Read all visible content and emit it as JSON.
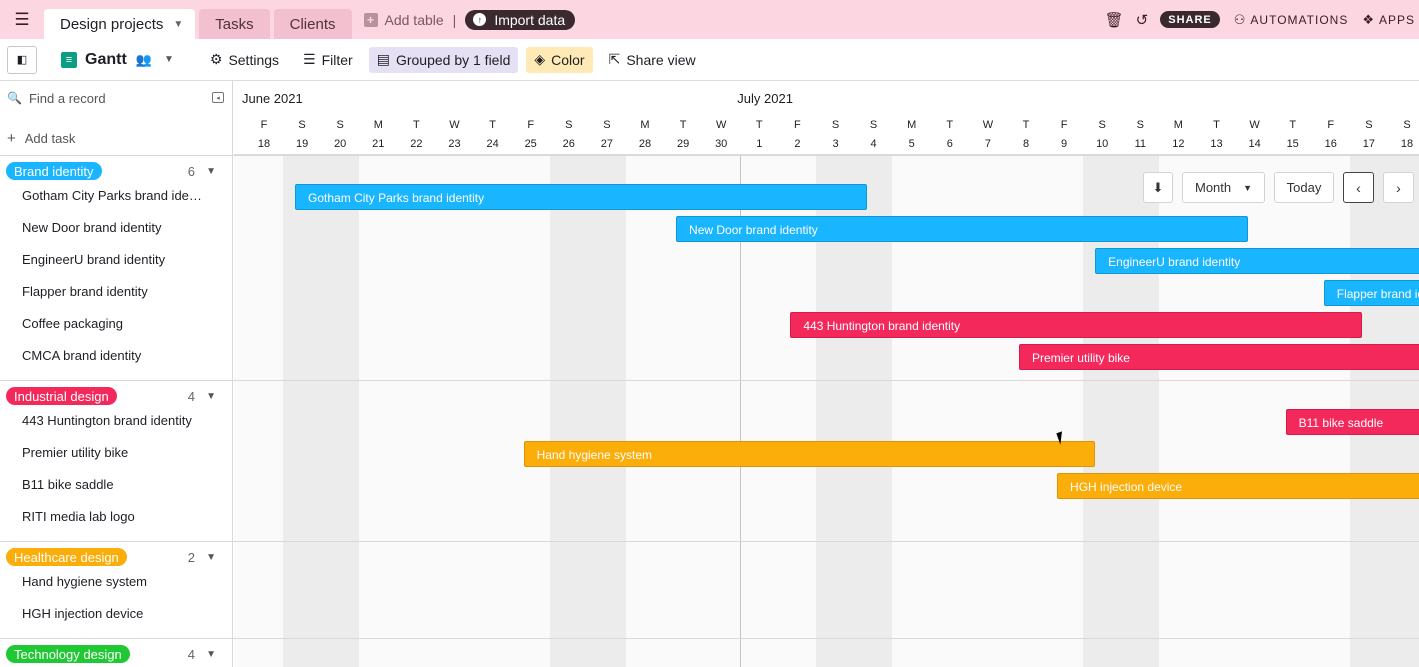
{
  "topbar": {
    "base_name": "Design projects",
    "tabs": [
      "Tasks",
      "Clients"
    ],
    "add_table": "Add table",
    "separator": "|",
    "import_label": "Import data",
    "share_label": "SHARE",
    "automations_label": "AUTOMATIONS",
    "apps_label": "APPS"
  },
  "viewbar": {
    "view_name": "Gantt",
    "settings": "Settings",
    "filter": "Filter",
    "grouped": "Grouped by 1 field",
    "color": "Color",
    "share_view": "Share view"
  },
  "left": {
    "search_placeholder": "Find a record",
    "add_task": "Add task",
    "groups": [
      {
        "name": "Brand identity",
        "count": "6",
        "color": "#19b5fe",
        "tasks": [
          "Gotham City Parks brand identity",
          "New Door brand identity",
          "EngineerU brand identity",
          "Flapper brand identity",
          "Coffee packaging",
          "CMCA brand identity"
        ]
      },
      {
        "name": "Industrial design",
        "count": "4",
        "color": "#f3295c",
        "tasks": [
          "443 Huntington brand identity",
          "Premier utility bike",
          "B11 bike saddle",
          "RITI media lab logo"
        ]
      },
      {
        "name": "Healthcare design",
        "count": "2",
        "color": "#fbad0a",
        "tasks": [
          "Hand hygiene system",
          "HGH injection device"
        ]
      },
      {
        "name": "Technology design",
        "count": "4",
        "color": "#20c933",
        "tasks": []
      }
    ]
  },
  "timeline": {
    "months": [
      {
        "label": "June 2021",
        "day_index": 0
      },
      {
        "label": "July 2021",
        "day_index": 13
      }
    ],
    "days": [
      {
        "w": "F",
        "d": "18"
      },
      {
        "w": "S",
        "d": "19"
      },
      {
        "w": "S",
        "d": "20"
      },
      {
        "w": "M",
        "d": "21"
      },
      {
        "w": "T",
        "d": "22"
      },
      {
        "w": "W",
        "d": "23"
      },
      {
        "w": "T",
        "d": "24"
      },
      {
        "w": "F",
        "d": "25"
      },
      {
        "w": "S",
        "d": "26"
      },
      {
        "w": "S",
        "d": "27"
      },
      {
        "w": "M",
        "d": "28"
      },
      {
        "w": "T",
        "d": "29"
      },
      {
        "w": "W",
        "d": "30"
      },
      {
        "w": "T",
        "d": "1"
      },
      {
        "w": "F",
        "d": "2"
      },
      {
        "w": "S",
        "d": "3"
      },
      {
        "w": "S",
        "d": "4"
      },
      {
        "w": "M",
        "d": "5"
      },
      {
        "w": "T",
        "d": "6"
      },
      {
        "w": "W",
        "d": "7"
      },
      {
        "w": "T",
        "d": "8"
      },
      {
        "w": "F",
        "d": "9"
      },
      {
        "w": "S",
        "d": "10"
      },
      {
        "w": "S",
        "d": "11"
      },
      {
        "w": "M",
        "d": "12"
      },
      {
        "w": "T",
        "d": "13"
      },
      {
        "w": "W",
        "d": "14"
      },
      {
        "w": "T",
        "d": "15"
      },
      {
        "w": "F",
        "d": "16"
      },
      {
        "w": "S",
        "d": "17"
      },
      {
        "w": "S",
        "d": "18"
      }
    ],
    "today_index": 13,
    "controls": {
      "scale": "Month",
      "today": "Today"
    },
    "bars": [
      {
        "label": "Gotham City Parks brand identity",
        "color": "blue",
        "start": 1,
        "end": 16
      },
      {
        "label": "New Door brand identity",
        "color": "blue",
        "start": 11,
        "end": 26
      },
      {
        "label": "EngineerU brand identity",
        "color": "blue",
        "start": 22,
        "end": 37
      },
      {
        "label": "Flapper brand identity",
        "color": "blue",
        "start": 28,
        "end": 43
      },
      {
        "label": "443 Huntington brand identity",
        "color": "red",
        "start": 14,
        "end": 29
      },
      {
        "label": "Premier utility bike",
        "color": "red",
        "start": 20,
        "end": 35
      },
      {
        "label": "B11 bike saddle",
        "color": "red",
        "start": 27,
        "end": 42
      },
      {
        "label": "Hand hygiene system",
        "color": "orange",
        "start": 7,
        "end": 22
      },
      {
        "label": "HGH injection device",
        "color": "orange",
        "start": 21,
        "end": 36
      }
    ]
  }
}
